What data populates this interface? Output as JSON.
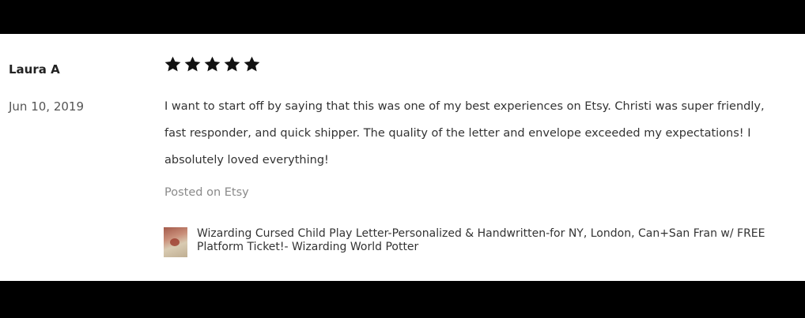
{
  "review": {
    "reviewer_name": "Laura A",
    "date": "Jun 10, 2019",
    "rating": 5,
    "text": "I want to start off by saying that this was one of my best experiences on Etsy. Christi was super friendly, fast responder, and quick shipper. The quality of the letter and envelope exceeded my expectations! I absolutely loved everything!",
    "posted_on": "Posted on Etsy",
    "listing_title": "Wizarding Cursed Child Play Letter-Personalized & Handwritten-for NY, London, Can+San Fran w/ FREE Platform Ticket!- Wizarding World Potter",
    "listing_image_icon": "letter-thumbnail"
  },
  "colors": {
    "bar": "#000000",
    "background": "#ffffff",
    "star": "#111111",
    "muted_text": "#8a8a8a"
  }
}
